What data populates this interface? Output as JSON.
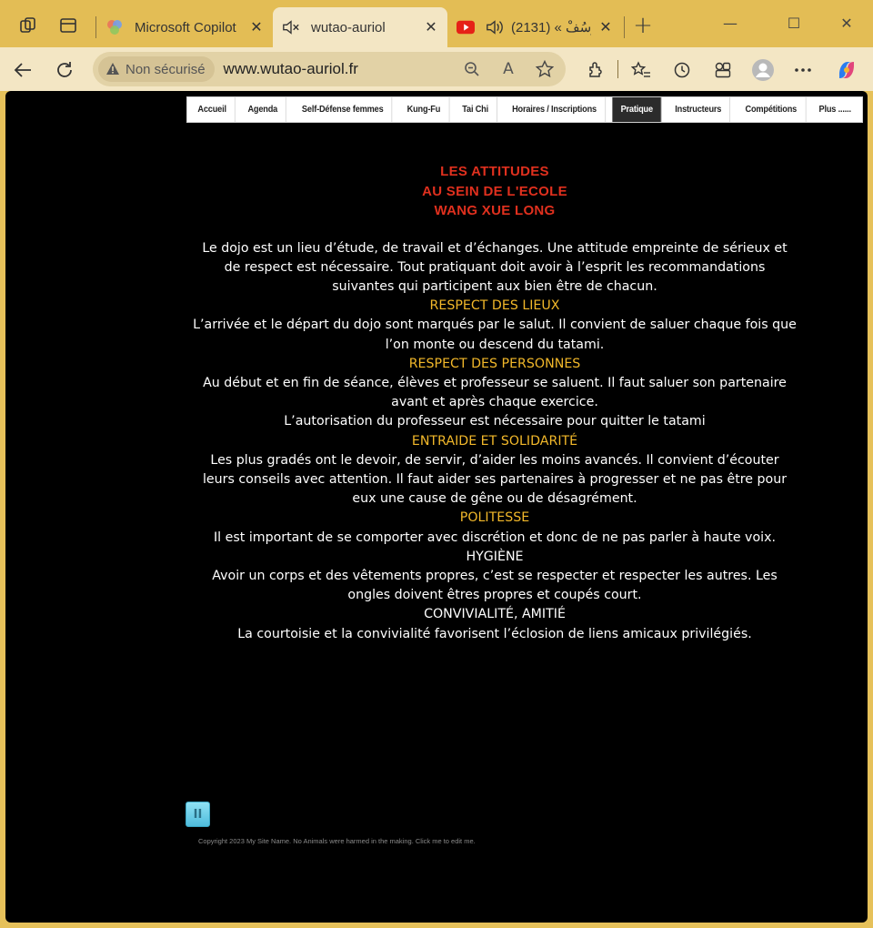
{
  "browser": {
    "tabs": [
      {
        "title": "Microsoft Copilot",
        "close": "✕"
      },
      {
        "title": "wutao-auriol",
        "close": "✕"
      },
      {
        "title": "يُوسُفْ » (2131)",
        "close": "✕"
      }
    ],
    "new_tab": "+",
    "window": {
      "minimize": "—",
      "maximize": "☐",
      "close": "✕"
    },
    "security_label": "Non sécurisé",
    "url": "www.wutao-auriol.fr",
    "read_aloud_label": "A",
    "accent_color": "#e6c15a"
  },
  "site": {
    "menu": [
      "Accueil",
      "Agenda",
      "Self-Défense femmes",
      "Kung-Fu",
      "Tai Chi",
      "Horaires / Inscriptions",
      "Pratique",
      "Instructeurs",
      "Compétitions",
      "Plus ......"
    ],
    "active_menu": "Pratique",
    "heading": [
      "LES ATTITUDES",
      "AU SEIN DE L'ECOLE",
      "WANG XUE LONG"
    ],
    "intro": "Le dojo est un lieu d’étude, de travail et d’échanges. Une attitude empreinte de sérieux et de respect est nécessaire. Tout  pratiquant doit avoir à l’esprit les recommandations suivantes qui participent aux bien être de chacun.",
    "sections": [
      {
        "title": "RESPECT DES LIEUX",
        "lines": [
          "L’arrivée et le départ du dojo sont marqués par le salut. Il convient de saluer chaque fois que l’on monte ou descend du tatami."
        ]
      },
      {
        "title": "RESPECT DES PERSONNES",
        "lines": [
          "Au début et en fin de séance, élèves et professeur se saluent. Il faut saluer son partenaire avant et après chaque exercice.",
          "L’autorisation du professeur est nécessaire pour quitter le tatami"
        ]
      },
      {
        "title": "ENTRAIDE ET SOLIDARITÉ",
        "lines": [
          "Les plus gradés ont le devoir, de servir, d’aider les moins avancés. Il convient d’écouter leurs conseils avec attention. Il faut aider ses partenaires à progresser et ne pas être pour eux une cause de gêne ou de désagrément."
        ]
      },
      {
        "title": "POLITESSE",
        "lines": [
          "Il est important de se comporter avec discrétion et donc de ne pas parler à haute voix."
        ]
      },
      {
        "title": "HYGIÈNE",
        "lines": [
          "Avoir un corps et des vêtements propres, c’est se respecter et respecter les autres. Les ongles doivent êtres propres et coupés court."
        ]
      },
      {
        "title": "CONVIVIALITÉ, AMITIÉ",
        "lines": [
          "La courtoisie et la convivialité favorisent l’éclosion de liens amicaux privilégiés."
        ]
      }
    ],
    "pause_label": "II",
    "copyright": "Copyright 2023 My Site Name. No Animals were harmed in the making. Click me to edit me.",
    "colors": {
      "heading": "#e0301e",
      "section_title": "#f2b82a",
      "background": "#000000"
    }
  }
}
